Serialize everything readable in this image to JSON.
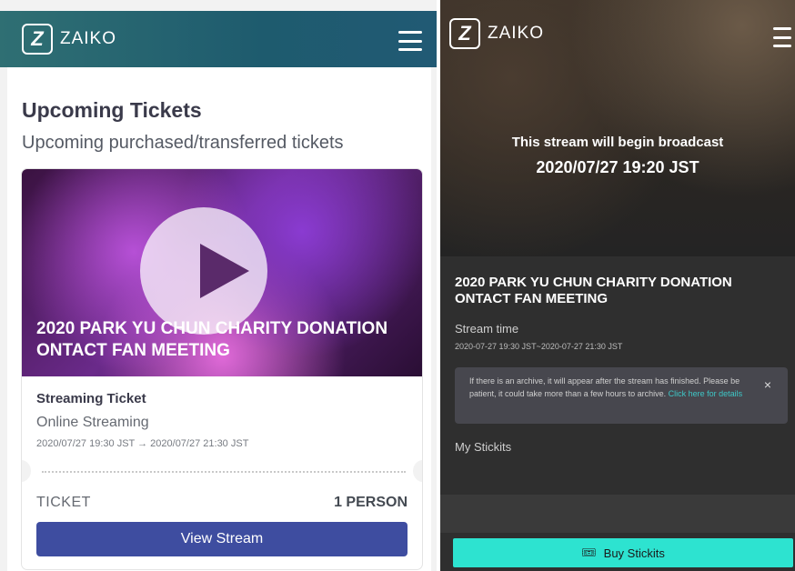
{
  "left_screen": {
    "brand": {
      "mark": "Z",
      "name": "ZAIKO"
    },
    "page_title": "Upcoming Tickets",
    "page_subtitle": "Upcoming purchased/transferred tickets",
    "ticket_card": {
      "event_title": "2020 PARK YU CHUN CHARITY DONATION ONTACT FAN MEETING",
      "ticket_type": "Streaming Ticket",
      "ticket_mode": "Online Streaming",
      "datetime": "2020/07/27 19:30 JST → 2020/07/27 21:30 JST",
      "ticket_label": "TICKET",
      "ticket_count": "1 PERSON",
      "view_button": "View Stream"
    }
  },
  "right_screen": {
    "brand": {
      "mark": "Z",
      "name": "ZAIKO"
    },
    "broadcast_notice_line1": "This stream will begin broadcast",
    "broadcast_notice_line2": "2020/07/27 19:20 JST",
    "event_title": "2020 PARK YU CHUN CHARITY DONATION ONTACT FAN MEETING",
    "stream_time_label": "Stream time",
    "stream_time_value": "2020-07-27 19:30 JST~2020-07-27 21:30 JST",
    "archive_notice": {
      "text": "If there is an archive, it will appear after the stream has finished. Please be patient, it could take more than a few hours to archive.",
      "link": "Click here for details",
      "close": "×"
    },
    "my_stickits_label": "My Stickits",
    "buy_button": {
      "icon": "ticket-icon",
      "glyph": "🎟",
      "label": "Buy Stickits"
    }
  },
  "colors": {
    "left_topbar": "#1e5b6e",
    "view_button": "#3e4da0",
    "right_background": "#2f2f2f",
    "buy_button": "#2de3d0",
    "link": "#3ec7c7"
  }
}
